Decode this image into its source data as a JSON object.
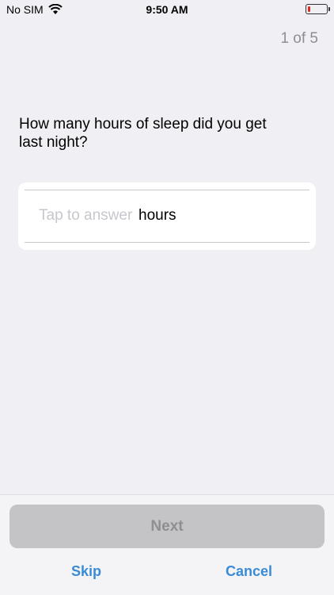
{
  "status_bar": {
    "carrier": "No SIM",
    "time": "9:50 AM",
    "battery_color": "#e0281f"
  },
  "progress": "1 of 5",
  "question": "How many hours of sleep did you get last night?",
  "answer": {
    "placeholder": "Tap to answer",
    "value": "",
    "unit": "hours"
  },
  "footer": {
    "next_label": "Next",
    "skip_label": "Skip",
    "cancel_label": "Cancel"
  },
  "colors": {
    "accent": "#3a8bd6",
    "background": "#efeff4",
    "disabled_button": "#c4c4c6"
  }
}
